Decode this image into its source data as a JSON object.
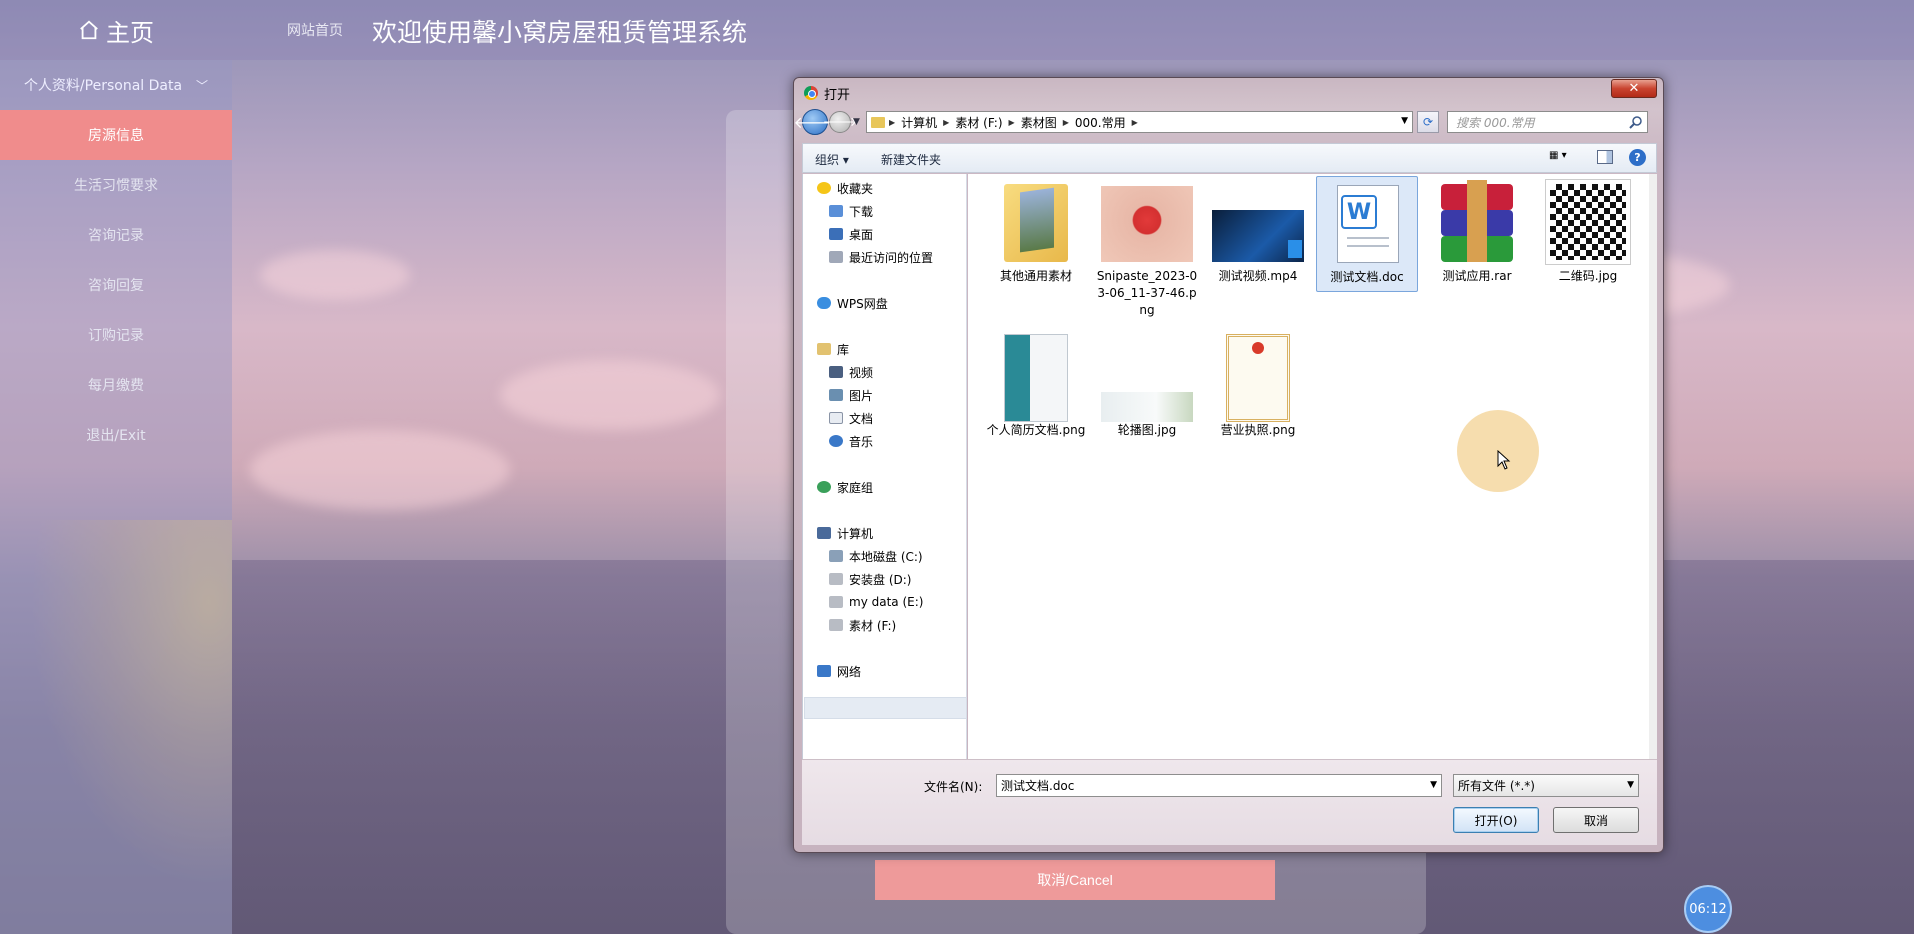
{
  "header": {
    "home_label": "主页",
    "site_link": "网站首页",
    "title": "欢迎使用馨小窝房屋租赁管理系统"
  },
  "sidebar": {
    "group_label": "个人资料/Personal Data",
    "items": [
      {
        "label": "房源信息",
        "active": true
      },
      {
        "label": "生活习惯要求",
        "active": false
      },
      {
        "label": "咨询记录",
        "active": false
      },
      {
        "label": "咨询回复",
        "active": false
      },
      {
        "label": "订购记录",
        "active": false
      },
      {
        "label": "每月缴费",
        "active": false
      },
      {
        "label": "退出/Exit",
        "active": false
      }
    ]
  },
  "form": {
    "cancel_label": "取消/Cancel"
  },
  "clock": {
    "time": "06:12"
  },
  "dialog": {
    "title": "打开",
    "close_label": "✕",
    "breadcrumb": [
      "计算机",
      "素材 (F:)",
      "素材图",
      "000.常用"
    ],
    "search_placeholder": "搜索 000.常用",
    "toolbar": {
      "organize": "组织 ▾",
      "new_folder": "新建文件夹"
    },
    "nav": {
      "favorites": "收藏夹",
      "downloads": "下载",
      "desktop": "桌面",
      "recent": "最近访问的位置",
      "wps": "WPS网盘",
      "library": "库",
      "video": "视频",
      "pictures": "图片",
      "documents": "文档",
      "music": "音乐",
      "homegroup": "家庭组",
      "computer": "计算机",
      "drive_c": "本地磁盘 (C:)",
      "drive_d": "安装盘 (D:)",
      "drive_e": "my data (E:)",
      "drive_f": "素材 (F:)",
      "network": "网络"
    },
    "files": [
      {
        "name": "其他通用素材",
        "icon": "folder-icon"
      },
      {
        "name": "Snipaste_2023-03-06_11-37-46.png",
        "icon": "image-heart-icon"
      },
      {
        "name": "测试视频.mp4",
        "icon": "video-icon"
      },
      {
        "name": "测试文档.doc",
        "icon": "word-doc-icon",
        "selected": true
      },
      {
        "name": "测试应用.rar",
        "icon": "rar-archive-icon"
      },
      {
        "name": "二维码.jpg",
        "icon": "qr-code-icon"
      },
      {
        "name": "个人简历文档.png",
        "icon": "resume-icon"
      },
      {
        "name": "轮播图.jpg",
        "icon": "banner-image-icon"
      },
      {
        "name": "营业执照.png",
        "icon": "license-icon"
      }
    ],
    "filename_label": "文件名(N):",
    "filename_value": "测试文档.doc",
    "filetype_value": "所有文件 (*.*)",
    "open_label": "打开(O)",
    "cancel_label": "取消"
  },
  "colors": {
    "accent_pink": "#f08c8c",
    "selection_blue": "#dce8f8"
  }
}
